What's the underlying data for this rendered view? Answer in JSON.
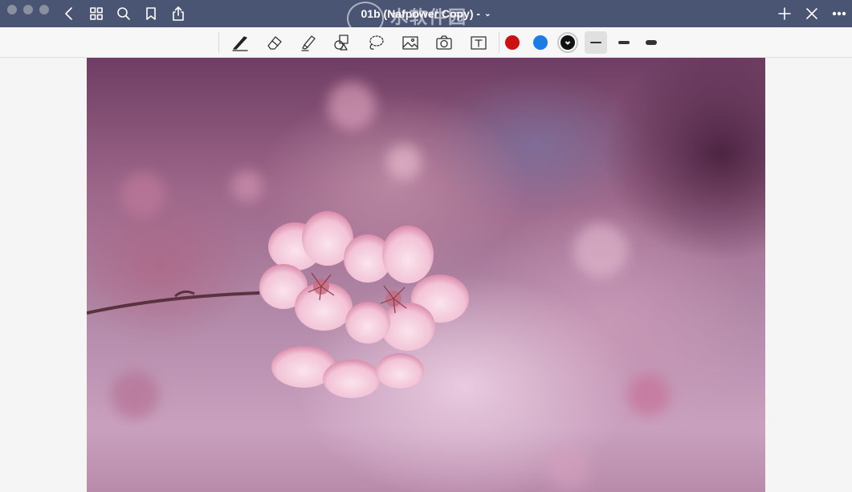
{
  "window": {
    "title": "01b (Nafpower Copy) - ",
    "title_chevron": "⌄"
  },
  "watermark": {
    "main_text": "水软件园",
    "url_text": "mac.orsoon.com"
  },
  "titlebar_buttons": {
    "back": "back-icon",
    "thumbnails": "grid-icon",
    "search": "search-icon",
    "bookmark": "bookmark-icon",
    "share": "share-icon",
    "add": "plus-icon",
    "close": "close-icon",
    "more": "more-icon"
  },
  "tools": [
    "pen",
    "eraser",
    "highlighter",
    "shapes",
    "lasso",
    "image",
    "camera",
    "text"
  ],
  "colors": {
    "red": "#cc1111",
    "blue": "#1a7de6",
    "black_selected": "#111111"
  },
  "stroke_widths": [
    "thin",
    "medium",
    "thick"
  ],
  "selected_stroke": "thin",
  "document": {
    "content": "cherry-blossom-photo"
  }
}
